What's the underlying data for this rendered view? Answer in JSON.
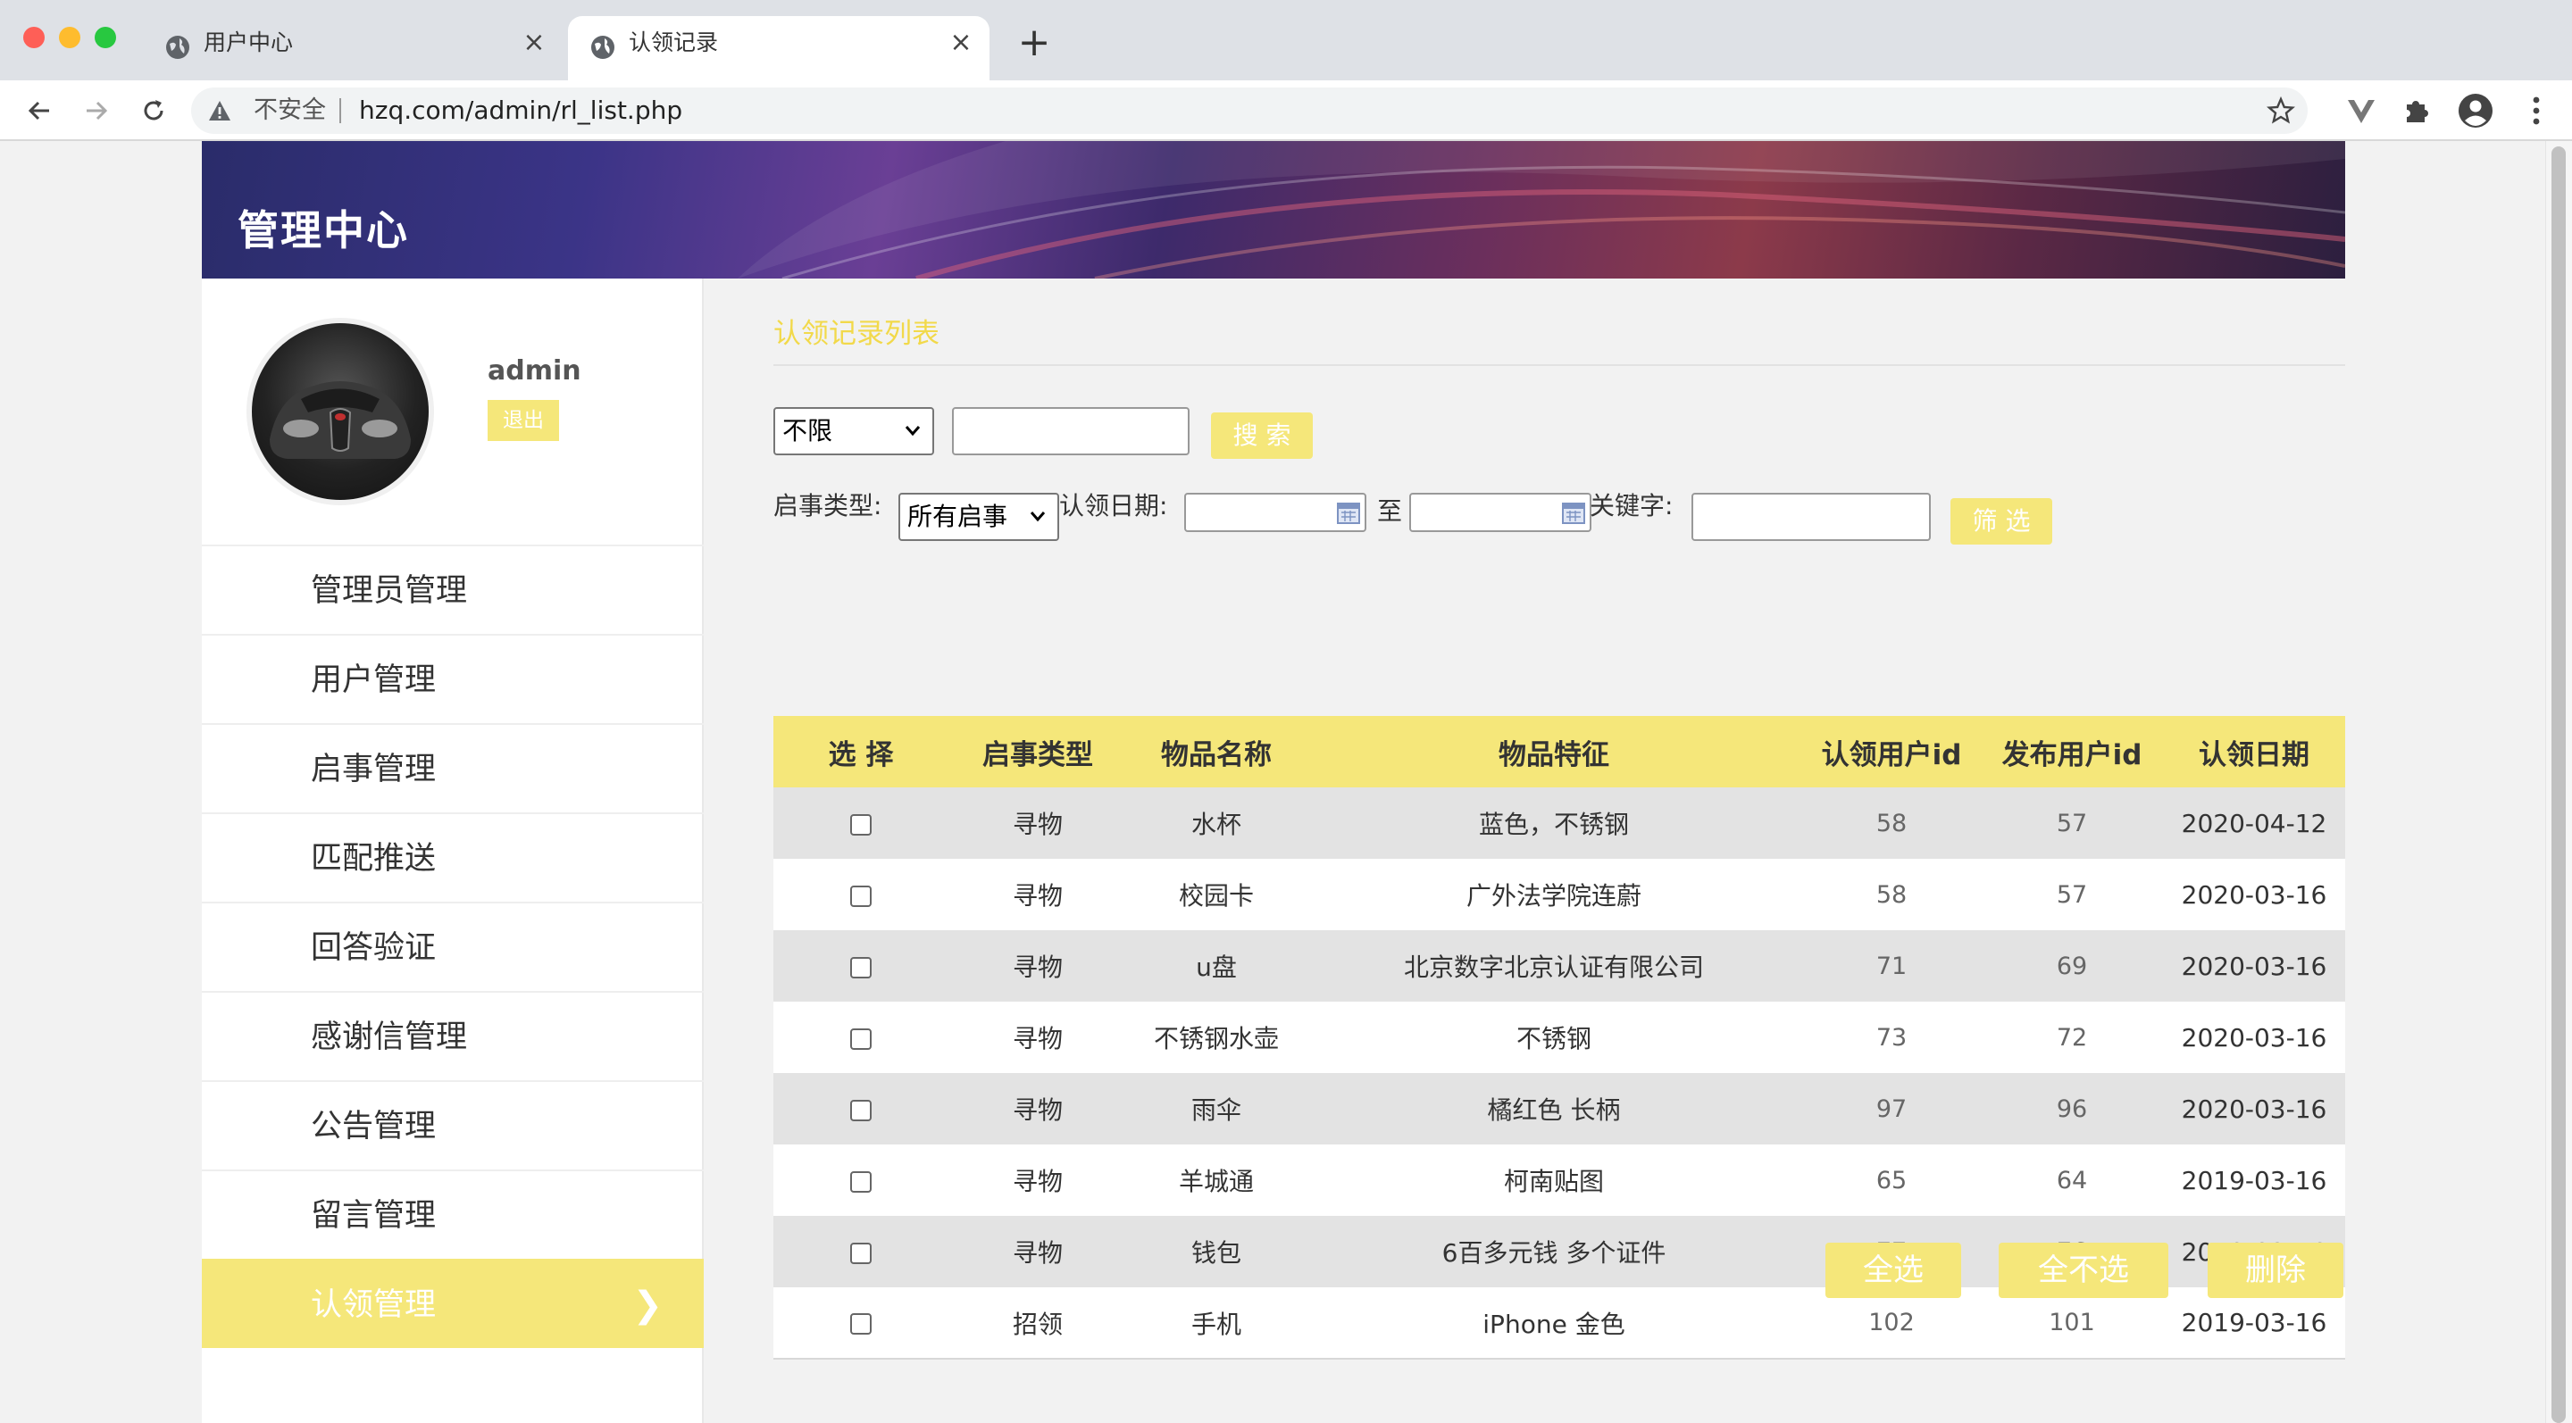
{
  "browser": {
    "tabs": [
      {
        "title": "用户中心",
        "active": false
      },
      {
        "title": "认领记录",
        "active": true
      }
    ],
    "omnibox": {
      "security_label": "不安全",
      "url": "hzq.com/admin/rl_list.php"
    },
    "icons": {
      "back": "arrow-left-icon",
      "forward": "arrow-right-icon",
      "reload": "reload-icon",
      "bookmark": "star-icon",
      "extension": "puzzle-icon",
      "profile": "account-icon",
      "menu": "kebab-menu-icon"
    }
  },
  "header": {
    "title": "管理中心"
  },
  "sidebar": {
    "username": "admin",
    "logout_label": "退出",
    "items": [
      {
        "label": "管理员管理"
      },
      {
        "label": "用户管理"
      },
      {
        "label": "启事管理"
      },
      {
        "label": "匹配推送"
      },
      {
        "label": "回答验证"
      },
      {
        "label": "感谢信管理"
      },
      {
        "label": "公告管理"
      },
      {
        "label": "留言管理"
      },
      {
        "label": "认领管理",
        "active": true,
        "chevron": "❯"
      }
    ]
  },
  "main": {
    "title": "认领记录列表",
    "search": {
      "scope_selected": "不限",
      "query_value": "",
      "button_label": "搜 索"
    },
    "filter": {
      "type_label": "启事类型:",
      "type_selected": "所有启事",
      "date_label": "认领日期:",
      "date_to_label": "至",
      "date_from_value": "",
      "date_to_value": "",
      "keyword_label": "关键字:",
      "keyword_value": "",
      "button_label": "筛 选"
    },
    "table": {
      "headers": [
        "选 择",
        "启事类型",
        "物品名称",
        "物品特征",
        "认领用户id",
        "发布用户id",
        "认领日期"
      ],
      "rows": [
        {
          "type": "寻物",
          "name": "水杯",
          "feature": "蓝色，不锈钢",
          "claim_uid": "58",
          "post_uid": "57",
          "date": "2020-04-12"
        },
        {
          "type": "寻物",
          "name": "校园卡",
          "feature": "广外法学院连蔚",
          "claim_uid": "58",
          "post_uid": "57",
          "date": "2020-03-16"
        },
        {
          "type": "寻物",
          "name": "u盘",
          "feature": "北京数字北京认证有限公司",
          "claim_uid": "71",
          "post_uid": "69",
          "date": "2020-03-16"
        },
        {
          "type": "寻物",
          "name": "不锈钢水壶",
          "feature": "不锈钢",
          "claim_uid": "73",
          "post_uid": "72",
          "date": "2020-03-16"
        },
        {
          "type": "寻物",
          "name": "雨伞",
          "feature": "橘红色 长柄",
          "claim_uid": "97",
          "post_uid": "96",
          "date": "2020-03-16"
        },
        {
          "type": "寻物",
          "name": "羊城通",
          "feature": "柯南贴图",
          "claim_uid": "65",
          "post_uid": "64",
          "date": "2019-03-16"
        },
        {
          "type": "寻物",
          "name": "钱包",
          "feature": "6百多元钱 多个证件",
          "claim_uid": "77",
          "post_uid": "76",
          "date": "2019-03-16"
        },
        {
          "type": "招领",
          "name": "手机",
          "feature": "iPhone 金色",
          "claim_uid": "102",
          "post_uid": "101",
          "date": "2019-03-16"
        }
      ]
    },
    "actions": {
      "select_all": "全选",
      "select_none": "全不选",
      "delete": "删除"
    }
  },
  "colors": {
    "accent_yellow": "#f5e77a",
    "title_yellow": "#f2d94a",
    "row_alt": "#e3e3e3"
  }
}
